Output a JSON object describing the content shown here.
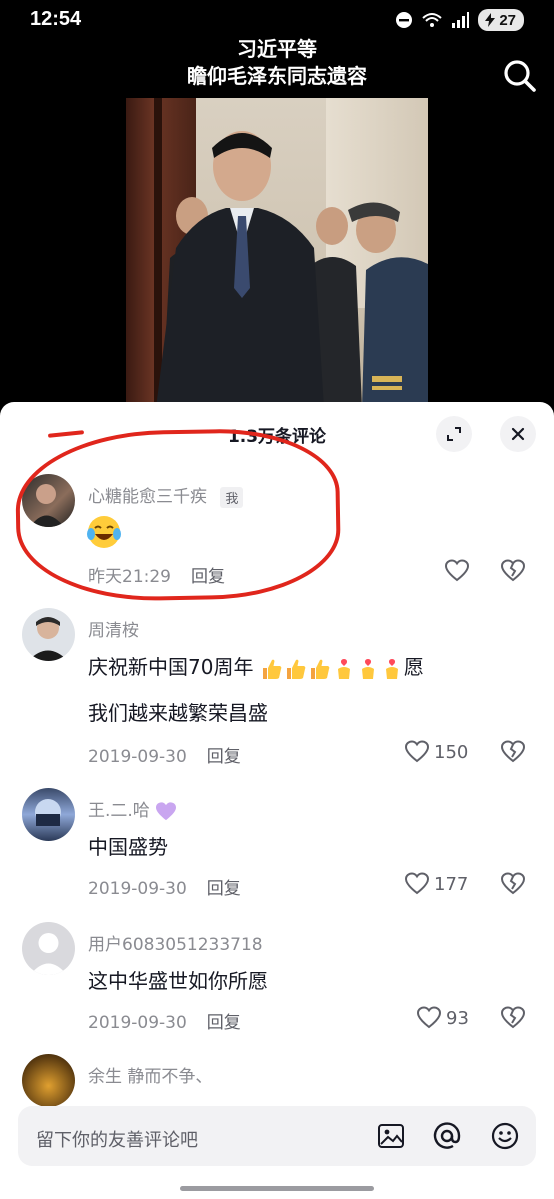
{
  "status": {
    "time": "12:54",
    "battery": "27"
  },
  "video": {
    "title_line1": "习近平等",
    "title_line2": "瞻仰毛泽东同志遗容"
  },
  "panel": {
    "comment_count": "1.3万条评论"
  },
  "comments": [
    {
      "user": "心糖能愈三千疾",
      "badge": "我",
      "text": "",
      "time": "昨天21:29",
      "reply": "回复",
      "likes": ""
    },
    {
      "user": "周清桉",
      "text_line1": "庆祝新中国70周年",
      "text_line1_end": "愿",
      "text_line2": "我们越来越繁荣昌盛",
      "time": "2019-09-30",
      "reply": "回复",
      "likes": "150"
    },
    {
      "user": "王.二.哈",
      "text": "中国盛势",
      "time": "2019-09-30",
      "reply": "回复",
      "likes": "177"
    },
    {
      "user": "用户6083051233718",
      "text": "这中华盛世如你所愿",
      "time": "2019-09-30",
      "reply": "回复",
      "likes": "93"
    },
    {
      "user": "余生 静而不争、"
    }
  ],
  "input": {
    "placeholder": "留下你的友善评论吧"
  },
  "colors": {
    "highlight": "#e0261c",
    "panel_bg": "#ffffff",
    "muted_text": "#8a8b91"
  },
  "icons": [
    "search-icon",
    "expand-icon",
    "close-icon",
    "heart-icon",
    "broken-heart-icon",
    "image-icon",
    "at-icon",
    "emoji-icon"
  ]
}
